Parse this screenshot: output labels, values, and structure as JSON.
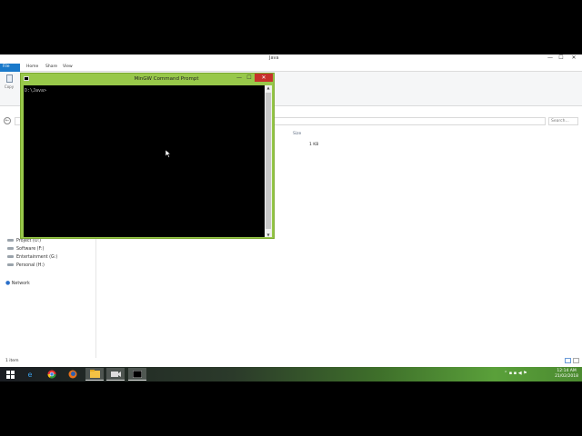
{
  "explorer": {
    "title": "Java",
    "tabs": [
      "File",
      "Home",
      "Share",
      "View"
    ],
    "ribbon": {
      "copy_label": "Copy"
    },
    "search_placeholder": "Search...",
    "nav_items": [
      "Project (O:)",
      "Software (F:)",
      "Entertainment (G:)",
      "Personal (H:)"
    ],
    "network_label": "Network",
    "column_size": "Size",
    "file_size_value": "1 KB",
    "status": "1 item"
  },
  "cmd": {
    "title": "MinGW Command Prompt",
    "prompt_line": "D:\\Java>",
    "close_glyph": "✕",
    "min_glyph": "—",
    "max_glyph": "☐"
  },
  "taskbar": {
    "time": "12:14 AM",
    "date": "21/02/2018"
  },
  "colors": {
    "cmd_frame": "#98c84a",
    "close_red": "#c7312a",
    "file_tab": "#1979ca"
  }
}
